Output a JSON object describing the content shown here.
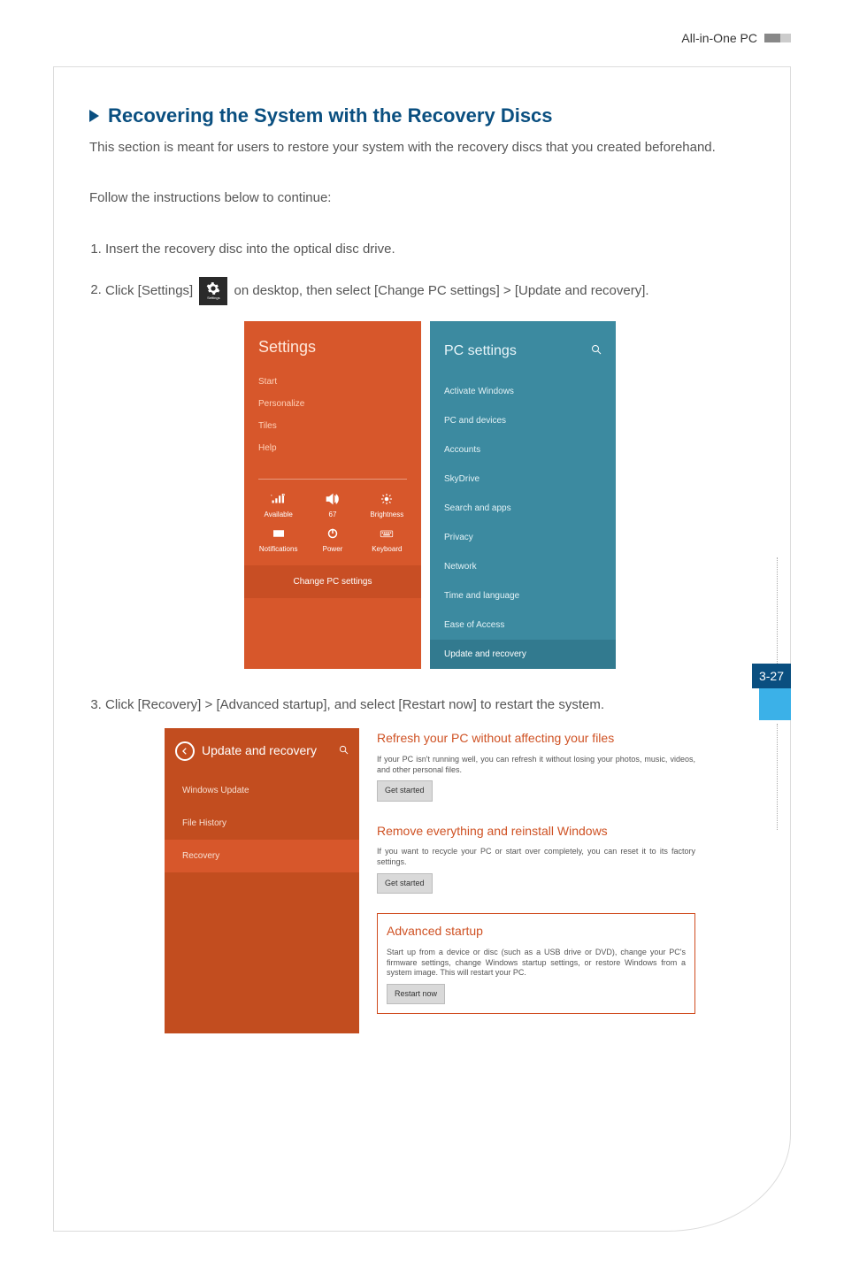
{
  "header": {
    "brand": "All-in-One PC"
  },
  "side": {
    "page_label": "3-27"
  },
  "main": {
    "heading": "Recovering the System with the Recovery Discs",
    "intro": "This section is meant for users to restore your system with the recovery discs that you created beforehand.",
    "follow": "Follow the instructions below to continue:",
    "step1": "Insert the recovery disc into the optical disc drive.",
    "step2_a": "Click [Settings]",
    "step2_b": "on desktop, then select [Change PC settings] > [Update and recovery].",
    "step3": "Click [Recovery] > [Advanced startup], and select [Restart now] to restart the system."
  },
  "settings_tile": {
    "label": "Settings"
  },
  "charm": {
    "title": "Settings",
    "menu": {
      "start": "Start",
      "personalize": "Personalize",
      "tiles": "Tiles",
      "help": "Help"
    },
    "tiles": {
      "network_label": "Available",
      "volume_label": "67",
      "brightness_label": "Brightness",
      "notifications_label": "Notifications",
      "power_label": "Power",
      "keyboard_label": "Keyboard"
    },
    "change": "Change PC settings"
  },
  "pcsettings": {
    "title": "PC settings",
    "items": {
      "activate": "Activate Windows",
      "pc_devices": "PC and devices",
      "accounts": "Accounts",
      "skydrive": "SkyDrive",
      "search": "Search and apps",
      "privacy": "Privacy",
      "network": "Network",
      "time": "Time and language",
      "ease": "Ease of Access",
      "update": "Update and recovery"
    }
  },
  "update_panel": {
    "title": "Update and recovery",
    "items": {
      "wu": "Windows Update",
      "fh": "File History",
      "rec": "Recovery"
    }
  },
  "recovery": {
    "refresh": {
      "title": "Refresh your PC without affecting your files",
      "desc": "If your PC isn't running well, you can refresh it without losing your photos, music, videos, and other personal files.",
      "button": "Get started"
    },
    "remove": {
      "title": "Remove everything and reinstall Windows",
      "desc": "If you want to recycle your PC or start over completely, you can reset it to its factory settings.",
      "button": "Get started"
    },
    "advanced": {
      "title": "Advanced startup",
      "desc": "Start up from a device or disc (such as a USB drive or DVD), change your PC's firmware settings, change Windows startup settings, or restore Windows from a system image. This will restart your PC.",
      "button": "Restart now"
    }
  }
}
